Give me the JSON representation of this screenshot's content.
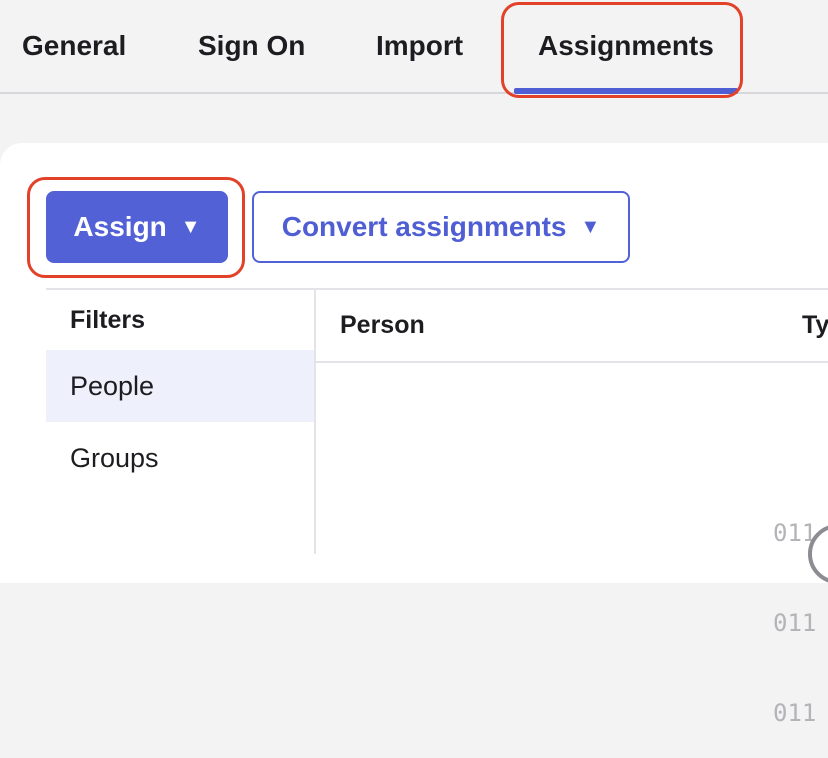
{
  "tabs": [
    {
      "label": "General"
    },
    {
      "label": "Sign On"
    },
    {
      "label": "Import"
    },
    {
      "label": "Assignments",
      "active": true
    }
  ],
  "toolbar": {
    "assign_label": "Assign",
    "assign_caret": "▼",
    "convert_label": "Convert assignments",
    "convert_caret": "▼"
  },
  "filters": {
    "title": "Filters",
    "items": [
      {
        "label": "People",
        "selected": true
      },
      {
        "label": "Groups"
      }
    ]
  },
  "table": {
    "columns": [
      "Person",
      "Ty"
    ]
  },
  "loading_glyph": [
    "011",
    "011",
    "011"
  ],
  "colors": {
    "accent": "#5261d6",
    "highlight": "#e2412a",
    "selected_bg": "#eef0fb"
  }
}
